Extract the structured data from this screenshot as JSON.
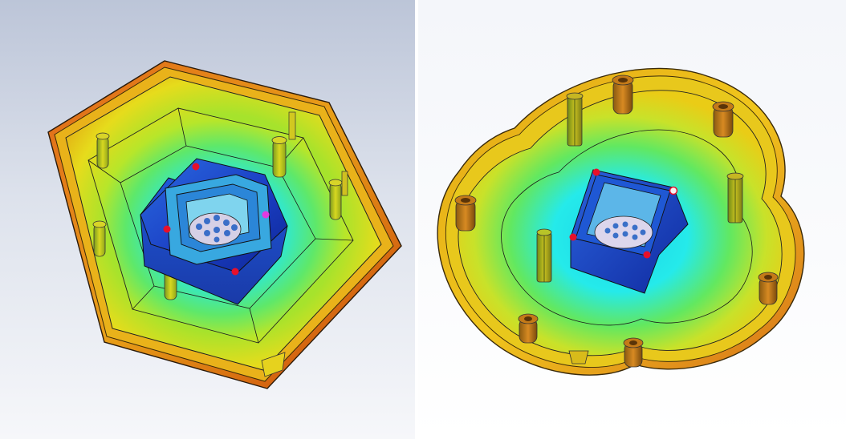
{
  "views": [
    {
      "name": "hexagonal-enclosure-view"
    },
    {
      "name": "trefoil-enclosure-view"
    }
  ],
  "colors": {
    "background_top": "#b9c3d6",
    "background_bottom": "#f4f6fa",
    "rim_hot": "#d94a10",
    "rim_mid": "#e58a12",
    "wall_yellow": "#e8e020",
    "wall_green": "#7fdd2a",
    "floor_cyan": "#22e6e6",
    "floor_teal": "#1fc3d8",
    "core_blue": "#1f47c8",
    "core_deep": "#0a1f8c",
    "pin_red": "#e8102a",
    "pin_magenta": "#e23adf",
    "edge_line": "#1a1a1a"
  }
}
